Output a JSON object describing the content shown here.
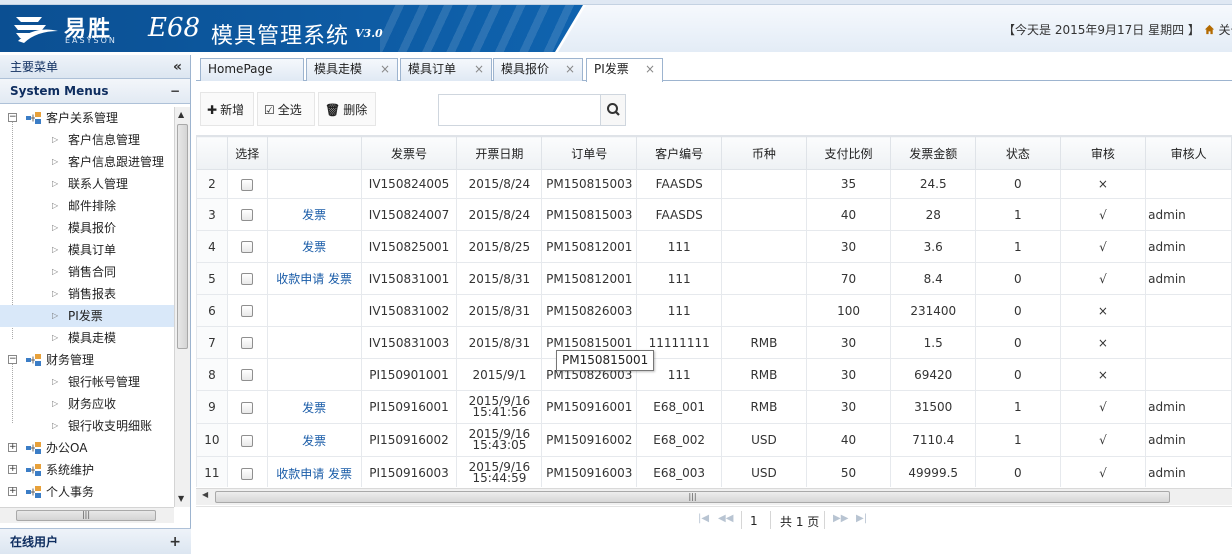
{
  "header": {
    "logo_cn": "易胜",
    "logo_en": "EASYSON",
    "app_name_latin": "E68",
    "app_name_cn": "模具管理系统",
    "version": "V3.0",
    "date_text": "【今天是 2015年9月17日 星期四 】",
    "about_label": "关于",
    "brand_color": "#0f62ad"
  },
  "sidebar": {
    "title": "主要菜单",
    "collapse_glyph": "«",
    "system_menus": "System Menus",
    "groups": [
      {
        "label": "客户关系管理",
        "expanded": true,
        "items": [
          "客户信息管理",
          "客户信息跟进管理",
          "联系人管理",
          "邮件排除",
          "模具报价",
          "模具订单",
          "销售合同",
          "销售报表",
          "PI发票",
          "模具走模"
        ]
      },
      {
        "label": "财务管理",
        "expanded": true,
        "items": [
          "银行帐号管理",
          "财务应收",
          "银行收支明细账"
        ]
      },
      {
        "label": "办公OA",
        "expanded": false,
        "items": []
      },
      {
        "label": "系统维护",
        "expanded": false,
        "items": []
      },
      {
        "label": "个人事务",
        "expanded": false,
        "items": []
      }
    ],
    "selected_item": "PI发票",
    "online_users": "在线用户"
  },
  "tabs": [
    {
      "label": "HomePage",
      "closable": false
    },
    {
      "label": "模具走模",
      "closable": true
    },
    {
      "label": "模具订单",
      "closable": true
    },
    {
      "label": "模具报价",
      "closable": true
    },
    {
      "label": "PI发票",
      "closable": true,
      "active": true
    }
  ],
  "toolbar": {
    "add_label": "新增",
    "select_all_label": "全选",
    "delete_label": "删除",
    "search_placeholder": ""
  },
  "table": {
    "columns": [
      "",
      "选择",
      "",
      "发票号",
      "开票日期",
      "订单号",
      "客户编号",
      "币种",
      "支付比例",
      "发票金额",
      "状态",
      "审核",
      "审核人"
    ],
    "rows": [
      {
        "n": "2",
        "links": "",
        "invoice": "IV150824005",
        "date": "2015/8/24",
        "date2": "",
        "order": "PM150815003",
        "customer": "FAASDS",
        "currency": "",
        "ratio": "35",
        "amount": "24.5",
        "status": "0",
        "audit": "×",
        "auditor": ""
      },
      {
        "n": "3",
        "links": "发票",
        "invoice": "IV150824007",
        "date": "2015/8/24",
        "date2": "",
        "order": "PM150815003",
        "customer": "FAASDS",
        "currency": "",
        "ratio": "40",
        "amount": "28",
        "status": "1",
        "audit": "√",
        "auditor": "admin"
      },
      {
        "n": "4",
        "links": "发票",
        "invoice": "IV150825001",
        "date": "2015/8/25",
        "date2": "",
        "order": "PM150812001",
        "customer": "111",
        "currency": "",
        "ratio": "30",
        "amount": "3.6",
        "status": "1",
        "audit": "√",
        "auditor": "admin"
      },
      {
        "n": "5",
        "links": "收款申请 发票",
        "invoice": "IV150831001",
        "date": "2015/8/31",
        "date2": "",
        "order": "PM150812001",
        "customer": "111",
        "currency": "",
        "ratio": "70",
        "amount": "8.4",
        "status": "0",
        "audit": "√",
        "auditor": "admin"
      },
      {
        "n": "6",
        "links": "",
        "invoice": "IV150831002",
        "date": "2015/8/31",
        "date2": "",
        "order": "PM150826003",
        "customer": "111",
        "currency": "",
        "ratio": "100",
        "amount": "231400",
        "status": "0",
        "audit": "×",
        "auditor": ""
      },
      {
        "n": "7",
        "links": "",
        "invoice": "IV150831003",
        "date": "2015/8/31",
        "date2": "",
        "order": "PM150815001",
        "customer": "11111111",
        "currency": "RMB",
        "ratio": "30",
        "amount": "1.5",
        "status": "0",
        "audit": "×",
        "auditor": ""
      },
      {
        "n": "8",
        "links": "",
        "invoice": "PI150901001",
        "date": "2015/9/1",
        "date2": "",
        "order": "PM150826003",
        "customer": "111",
        "currency": "RMB",
        "ratio": "30",
        "amount": "69420",
        "status": "0",
        "audit": "×",
        "auditor": ""
      },
      {
        "n": "9",
        "links": "发票",
        "invoice": "PI150916001",
        "date": "2015/9/16",
        "date2": "15:41:56",
        "order": "PM150916001",
        "customer": "E68_001",
        "currency": "RMB",
        "ratio": "30",
        "amount": "31500",
        "status": "1",
        "audit": "√",
        "auditor": "admin"
      },
      {
        "n": "10",
        "links": "发票",
        "invoice": "PI150916002",
        "date": "2015/9/16",
        "date2": "15:43:05",
        "order": "PM150916002",
        "customer": "E68_002",
        "currency": "USD",
        "ratio": "40",
        "amount": "7110.4",
        "status": "1",
        "audit": "√",
        "auditor": "admin"
      },
      {
        "n": "11",
        "links": "收款申请 发票",
        "invoice": "PI150916003",
        "date": "2015/9/16",
        "date2": "15:44:59",
        "order": "PM150916003",
        "customer": "E68_003",
        "currency": "USD",
        "ratio": "50",
        "amount": "49999.5",
        "status": "0",
        "audit": "√",
        "auditor": "admin"
      }
    ]
  },
  "tooltip": "PM150815001",
  "pager": {
    "page": "1",
    "total": "共 1 页"
  }
}
